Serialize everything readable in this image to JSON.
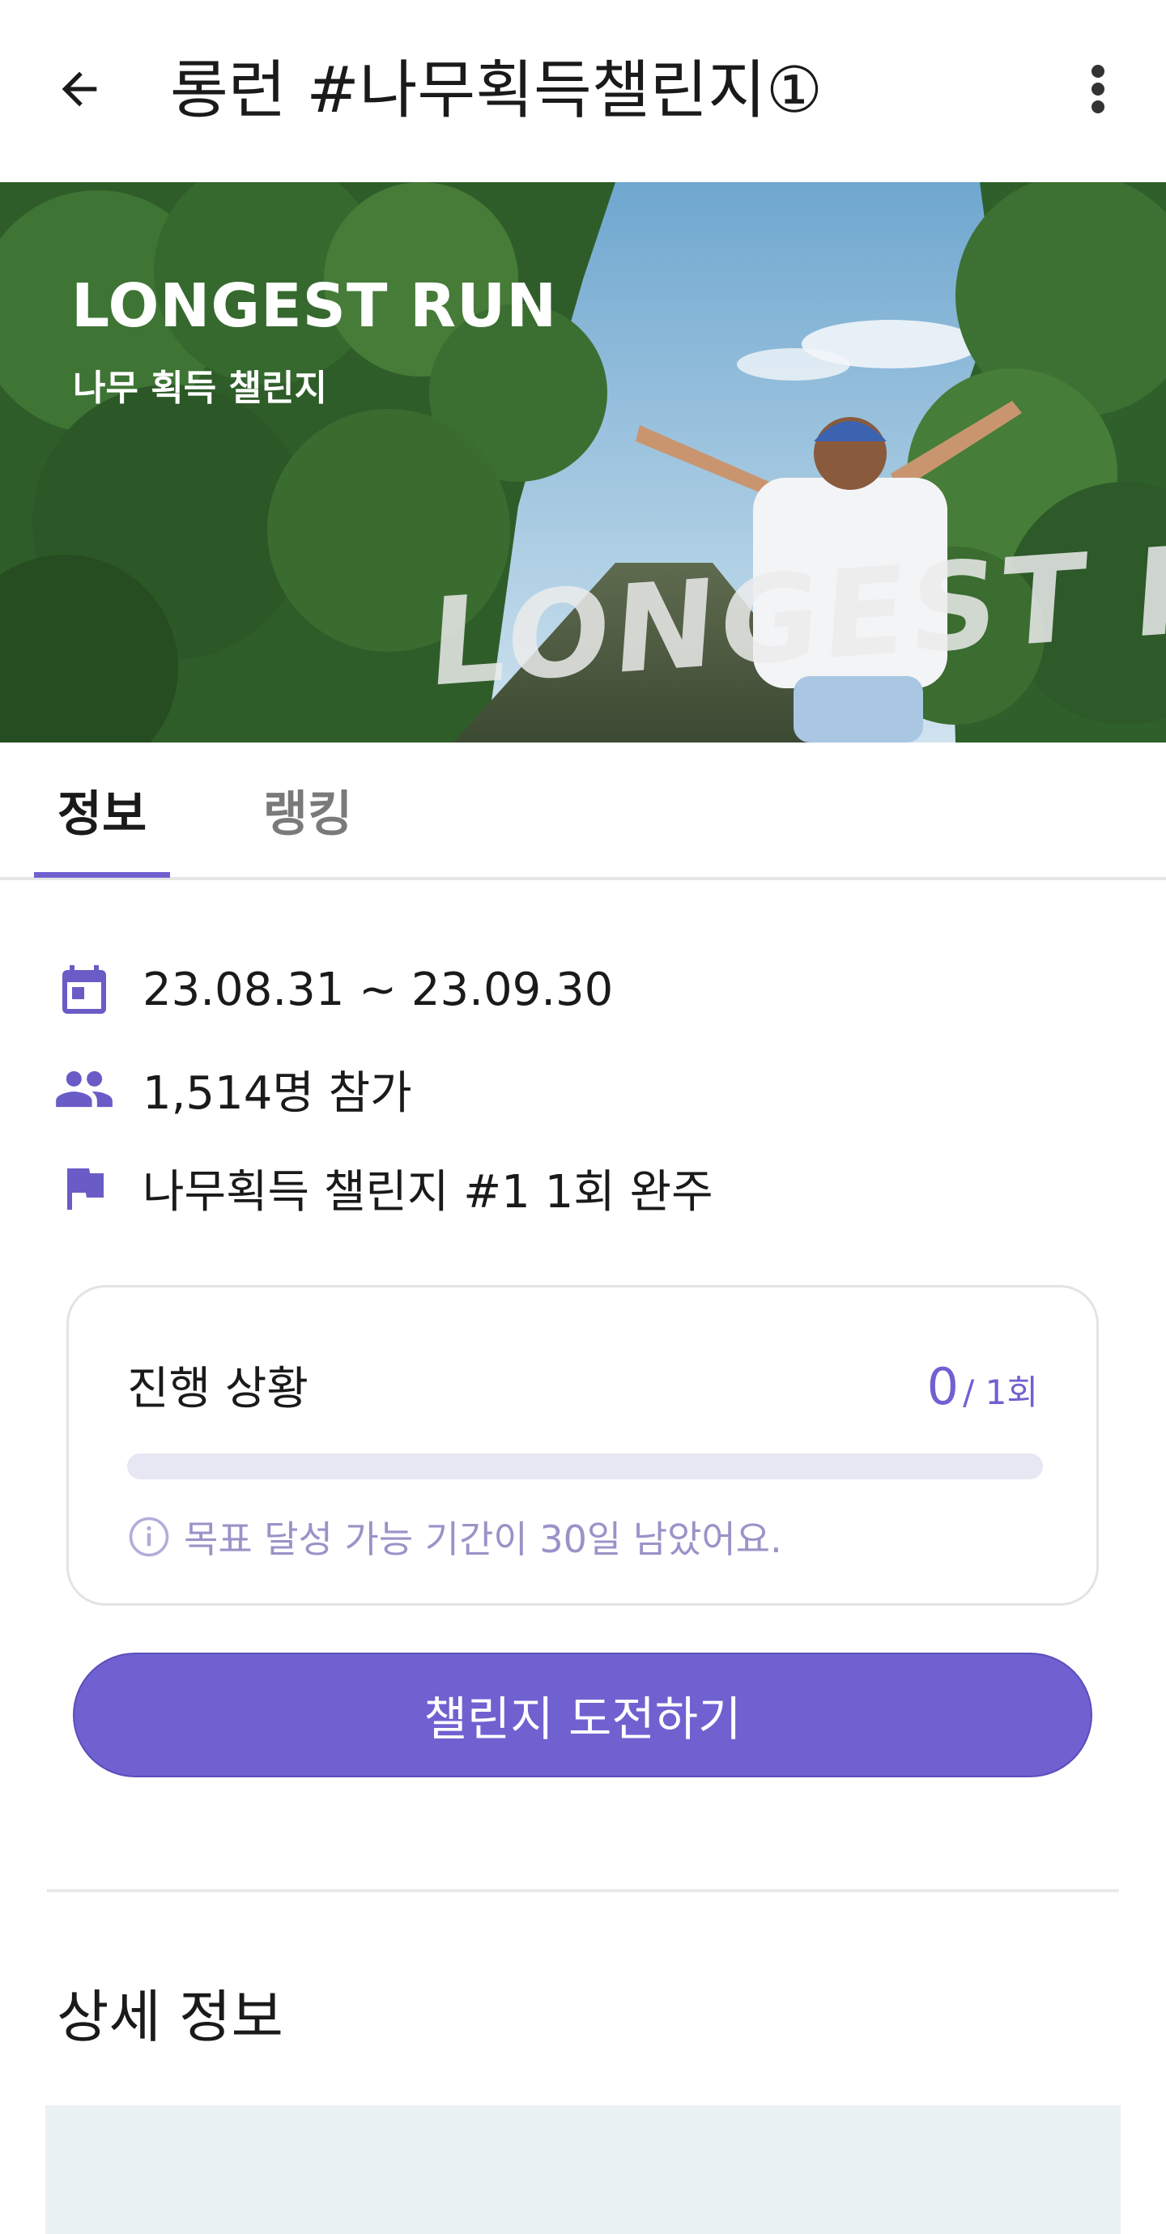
{
  "header": {
    "title": "롱런 #나무획득챌린지①",
    "back_icon": "arrow-left-icon",
    "more_icon": "more-vertical-icon"
  },
  "banner": {
    "title": "LONGEST RUN",
    "subtitle": "나무 획득 챌린지",
    "scene_text": "LONGEST RUN"
  },
  "tabs": [
    {
      "label": "정보",
      "selected": true
    },
    {
      "label": "랭킹",
      "selected": false
    }
  ],
  "meta": {
    "period": "23.08.31 ~ 23.09.30",
    "participants": "1,514명 참가",
    "goal": "나무획득 챌린지 #1 1회 완주"
  },
  "progress": {
    "label": "진행 상황",
    "current": "0",
    "total": "/ 1회",
    "fraction": 0,
    "note": "목표 달성 가능 기간이 30일 남았어요."
  },
  "cta": {
    "label": "챌린지 도전하기"
  },
  "details": {
    "section_title": "상세 정보"
  },
  "colors": {
    "accent": "#7061d1",
    "track": "#e6e7f3",
    "note": "#9a93c8",
    "placeholder": "#ebf2f4"
  }
}
